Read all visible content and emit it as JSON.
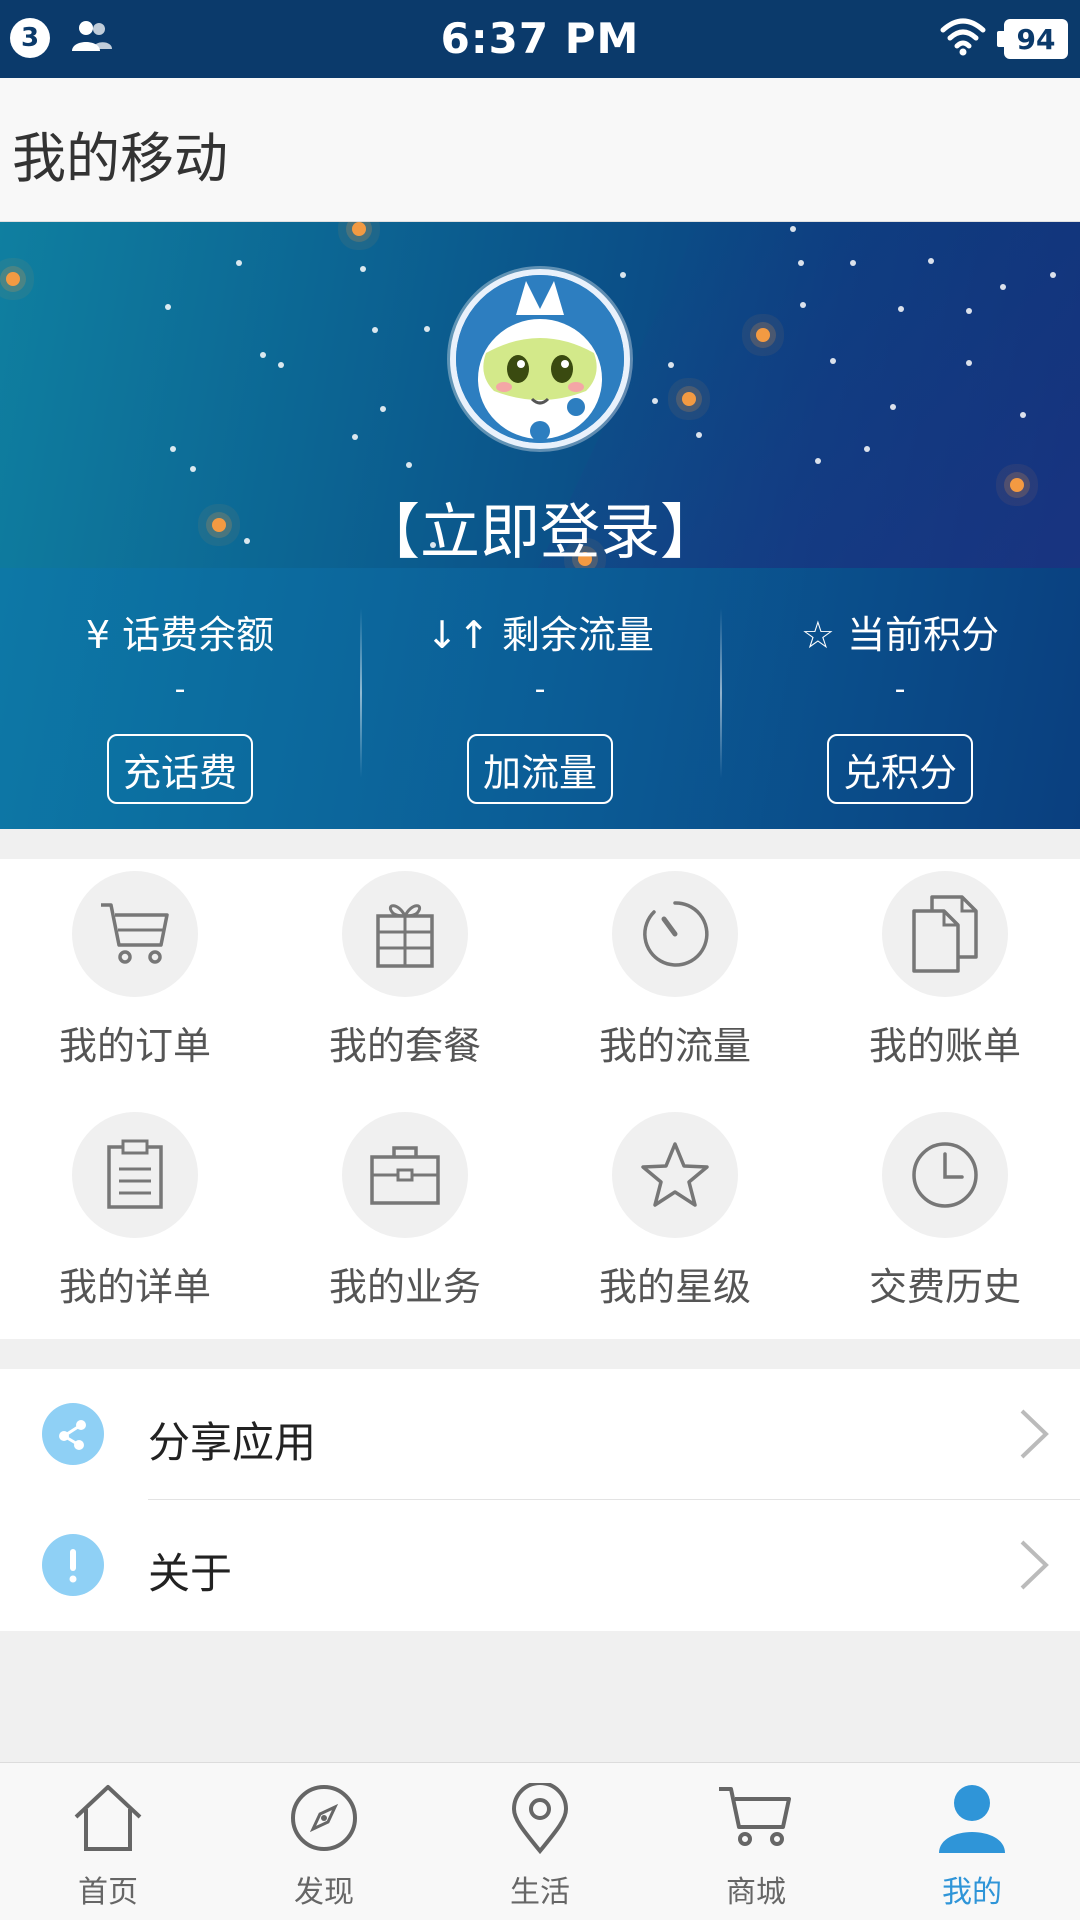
{
  "status_bar": {
    "notification_count": "3",
    "time": "6:37 PM",
    "battery": "94",
    "icons": [
      "contacts-icon",
      "wifi-icon",
      "battery-icon"
    ]
  },
  "header": {
    "title": "我的移动"
  },
  "banner": {
    "login_text": "【立即登录】"
  },
  "stats": [
    {
      "icon": "yen-icon",
      "icon_glyph": "¥",
      "label": "话费余额",
      "value": "-",
      "button": "充话费"
    },
    {
      "icon": "arrows-updown-icon",
      "icon_glyph": "↓↑",
      "label": "剩余流量",
      "value": "-",
      "button": "加流量"
    },
    {
      "icon": "star-outline-icon",
      "icon_glyph": "☆",
      "label": "当前积分",
      "value": "-",
      "button": "兑积分"
    }
  ],
  "grid": [
    {
      "label": "我的订单",
      "icon": "cart-icon"
    },
    {
      "label": "我的套餐",
      "icon": "gift-icon"
    },
    {
      "label": "我的流量",
      "icon": "gauge-icon"
    },
    {
      "label": "我的账单",
      "icon": "documents-icon"
    },
    {
      "label": "我的详单",
      "icon": "clipboard-icon"
    },
    {
      "label": "我的业务",
      "icon": "briefcase-icon"
    },
    {
      "label": "我的星级",
      "icon": "star-icon"
    },
    {
      "label": "交费历史",
      "icon": "clock-icon"
    }
  ],
  "list": [
    {
      "label": "分享应用",
      "icon": "share-icon"
    },
    {
      "label": "关于",
      "icon": "info-icon"
    }
  ],
  "tabs": [
    {
      "label": "首页",
      "icon": "home-icon",
      "active": false
    },
    {
      "label": "发现",
      "icon": "compass-icon",
      "active": false
    },
    {
      "label": "生活",
      "icon": "location-pin-icon",
      "active": false
    },
    {
      "label": "商城",
      "icon": "cart-icon",
      "active": false
    },
    {
      "label": "我的",
      "icon": "user-icon",
      "active": true
    }
  ],
  "colors": {
    "status_bar": "#0b3a6b",
    "accent": "#2f95d8",
    "orb": "#f39a42",
    "list_icon": "#8fd0f5"
  }
}
